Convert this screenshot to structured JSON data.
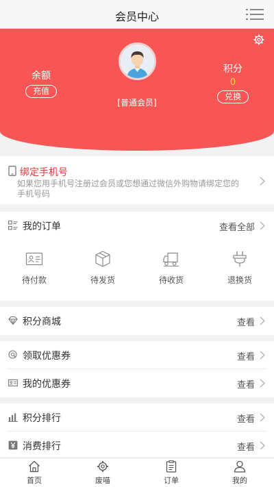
{
  "header": {
    "title": "会员中心",
    "menu_icon": "hamburger-menu-icon"
  },
  "profile": {
    "level": "[普通会员]",
    "balance_label": "余额",
    "recharge_label": "充值",
    "points_label": "积分",
    "points_value": "0",
    "redeem_label": "兑换",
    "accent_color": "#f75655"
  },
  "bind_phone": {
    "title": "绑定手机号",
    "description": "如果您用手机号注册过会员或您想通过微信外购物请绑定您的手机号码"
  },
  "orders": {
    "title": "我的订单",
    "view_all": "查看全部",
    "items": [
      {
        "label": "待付款",
        "icon": "pending-payment-icon"
      },
      {
        "label": "待发货",
        "icon": "package-box-icon"
      },
      {
        "label": "待收货",
        "icon": "delivery-truck-icon"
      },
      {
        "label": "退换货",
        "icon": "return-plug-icon"
      }
    ]
  },
  "points_mall": {
    "title": "积分商城",
    "link": "查看"
  },
  "coupons": {
    "get_title": "领取优惠券",
    "get_link": "查看",
    "mine_title": "我的优惠券",
    "mine_link": "查看"
  },
  "rankings": {
    "points_title": "积分排行",
    "points_link": "查看",
    "spend_title": "消费排行",
    "spend_link": "查看"
  },
  "tabbar": {
    "items": [
      {
        "label": "首页",
        "icon": "home-icon"
      },
      {
        "label": "废喵",
        "icon": "settings-gear-icon"
      },
      {
        "label": "订单",
        "icon": "order-list-icon"
      },
      {
        "label": "我的",
        "icon": "user-icon"
      }
    ]
  }
}
